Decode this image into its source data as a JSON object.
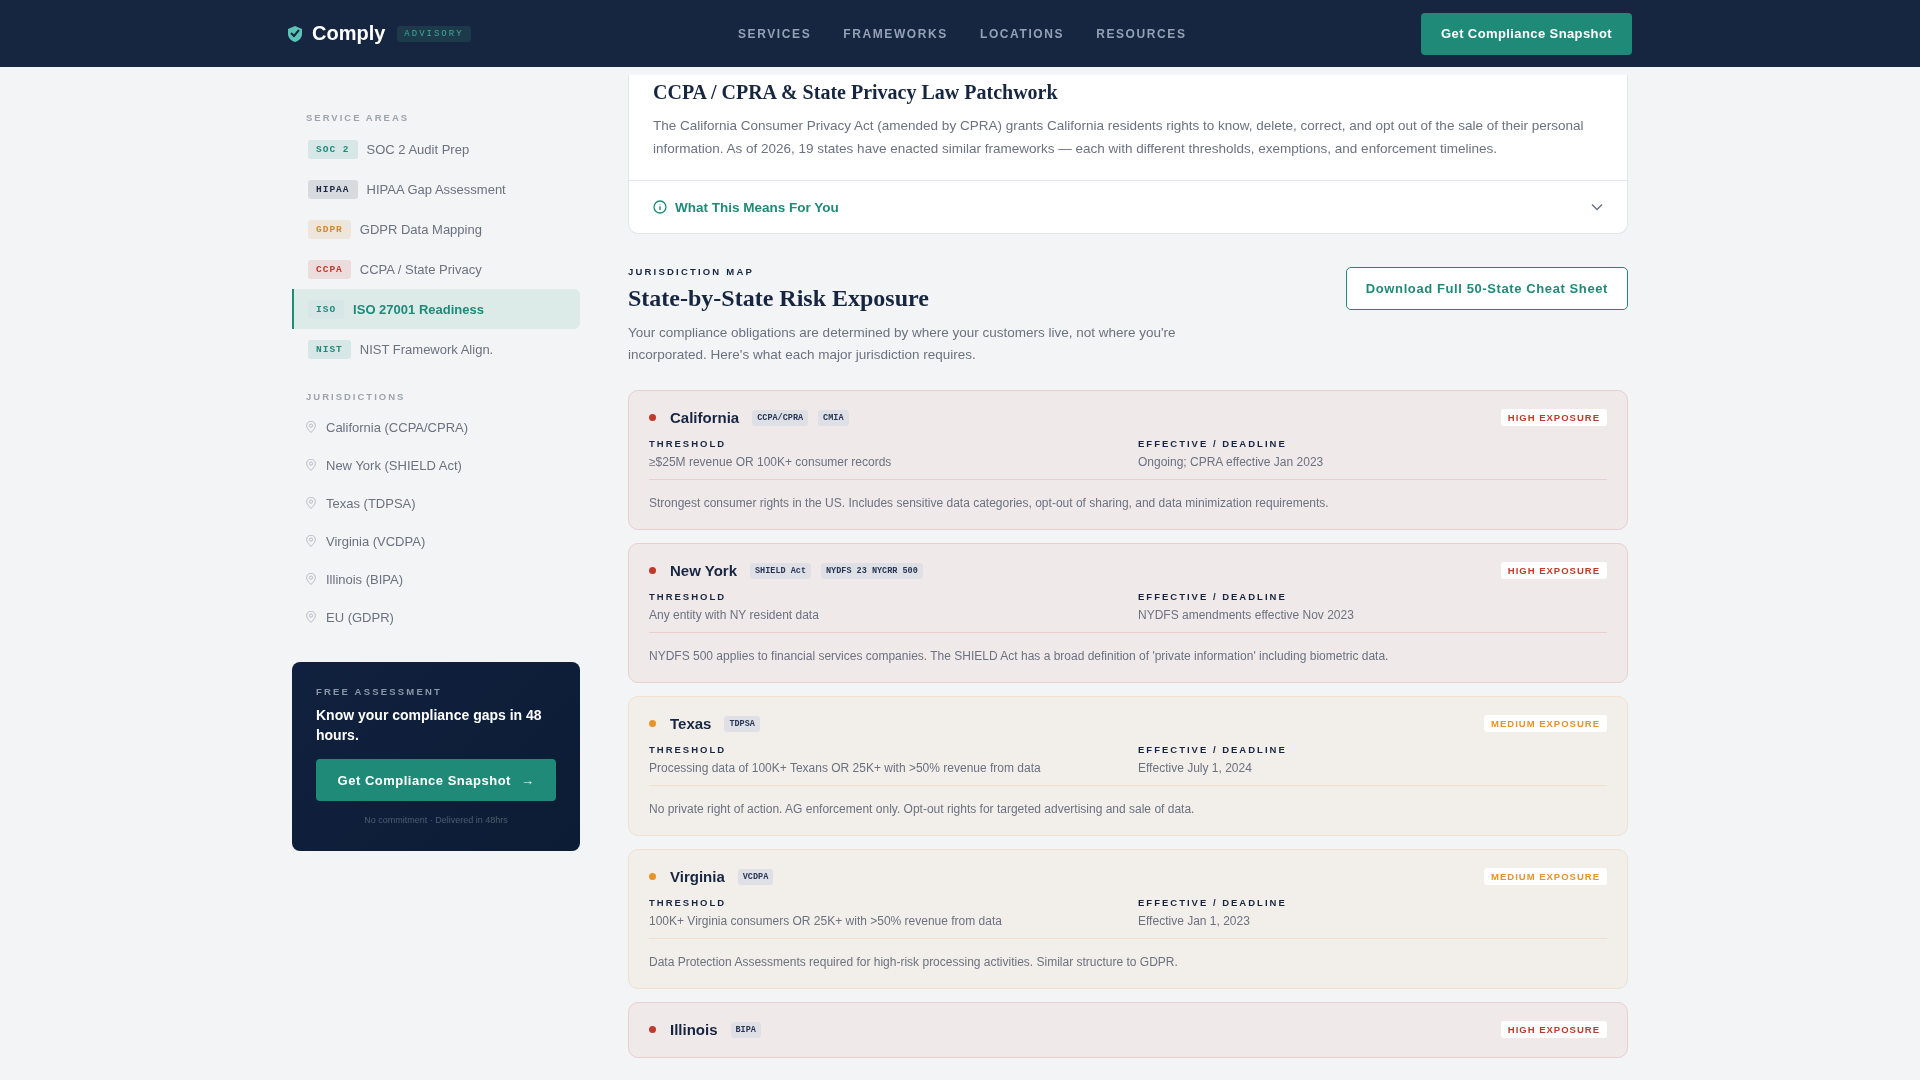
{
  "header": {
    "logo": "Comply",
    "logo_badge": "ADVISORY",
    "nav": [
      "SERVICES",
      "FRAMEWORKS",
      "LOCATIONS",
      "RESOURCES"
    ],
    "cta": "Get Compliance Snapshot"
  },
  "sidebar": {
    "service_areas": {
      "heading": "SERVICE AREAS",
      "items": [
        {
          "tag": "SOC 2",
          "label": "SOC 2 Audit Prep",
          "color": "#1f8a78",
          "selected": false
        },
        {
          "tag": "HIPAA",
          "label": "HIPAA Gap Assessment",
          "color": "#1e2a44",
          "selected": false
        },
        {
          "tag": "GDPR",
          "label": "GDPR Data Mapping",
          "color": "#d4872a",
          "selected": false
        },
        {
          "tag": "CCPA",
          "label": "CCPA / State Privacy",
          "color": "#c0392b",
          "selected": false
        },
        {
          "tag": "ISO",
          "label": "ISO 27001 Readiness",
          "color": "#1f8a78",
          "selected": true
        },
        {
          "tag": "NIST",
          "label": "NIST Framework Align.",
          "color": "#1f8a78",
          "selected": false
        }
      ]
    },
    "jurisdictions": {
      "heading": "JURISDICTIONS",
      "items": [
        "California (CCPA/CPRA)",
        "New York (SHIELD Act)",
        "Texas (TDPSA)",
        "Virginia (VCDPA)",
        "Illinois (BIPA)",
        "EU (GDPR)"
      ]
    },
    "promo": {
      "eyebrow": "FREE ASSESSMENT",
      "title": "Know your compliance gaps in 48 hours.",
      "button": "Get Compliance Snapshot",
      "button_icon": "→",
      "note": "No commitment · Delivered in 48hrs"
    }
  },
  "intro_card": {
    "title": "CCPA / CPRA & State Privacy Law Patchwork",
    "body": "The California Consumer Privacy Act (amended by CPRA) grants California residents rights to know, delete, correct, and opt out of the sale of their personal information. As of 2026, 19 states have enacted similar frameworks — each with different thresholds, exemptions, and enforcement timelines.",
    "disclosure": {
      "label": "What This Means For You",
      "expanded": false
    }
  },
  "jurisdiction_map": {
    "eyebrow": "JURISDICTION MAP",
    "title": "State-by-State Risk Exposure",
    "description": "Your compliance obligations are determined by where your customers live, not where you're incorporated. Here's what each major jurisdiction requires.",
    "download_button": "Download Full 50-State Cheat Sheet",
    "states": [
      {
        "name": "California",
        "tags": [
          "CCPA/CPRA",
          "CMIA"
        ],
        "color": "#c0392b",
        "exposure_label": "HIGH EXPOSURE",
        "threshold_label": "THRESHOLD",
        "threshold": "≥$25M revenue OR 100K+ consumer records",
        "deadline_label": "EFFECTIVE / DEADLINE",
        "deadline": "Ongoing; CPRA effective Jan 2023",
        "note": "Strongest consumer rights in the US. Includes sensitive data categories, opt-out of sharing, and data minimization requirements."
      },
      {
        "name": "New York",
        "tags": [
          "SHIELD Act",
          "NYDFS 23 NYCRR 500"
        ],
        "color": "#c0392b",
        "exposure_label": "HIGH EXPOSURE",
        "threshold_label": "THRESHOLD",
        "threshold": "Any entity with NY resident data",
        "deadline_label": "EFFECTIVE / DEADLINE",
        "deadline": "NYDFS amendments effective Nov 2023",
        "note": "NYDFS 500 applies to financial services companies. The SHIELD Act has a broad definition of 'private information' including biometric data."
      },
      {
        "name": "Texas",
        "tags": [
          "TDPSA"
        ],
        "color": "#e8922a",
        "exposure_label": "MEDIUM EXPOSURE",
        "threshold_label": "THRESHOLD",
        "threshold": "Processing data of 100K+ Texans OR 25K+ with >50% revenue from data",
        "deadline_label": "EFFECTIVE / DEADLINE",
        "deadline": "Effective July 1, 2024",
        "note": "No private right of action. AG enforcement only. Opt-out rights for targeted advertising and sale of data."
      },
      {
        "name": "Virginia",
        "tags": [
          "VCDPA"
        ],
        "color": "#e8922a",
        "exposure_label": "MEDIUM EXPOSURE",
        "threshold_label": "THRESHOLD",
        "threshold": "100K+ Virginia consumers OR 25K+ with >50% revenue from data",
        "deadline_label": "EFFECTIVE / DEADLINE",
        "deadline": "Effective Jan 1, 2023",
        "note": "Data Protection Assessments required for high-risk processing activities. Similar structure to GDPR."
      },
      {
        "name": "Illinois",
        "tags": [
          "BIPA"
        ],
        "color": "#c0392b",
        "exposure_label": "HIGH EXPOSURE"
      }
    ]
  }
}
